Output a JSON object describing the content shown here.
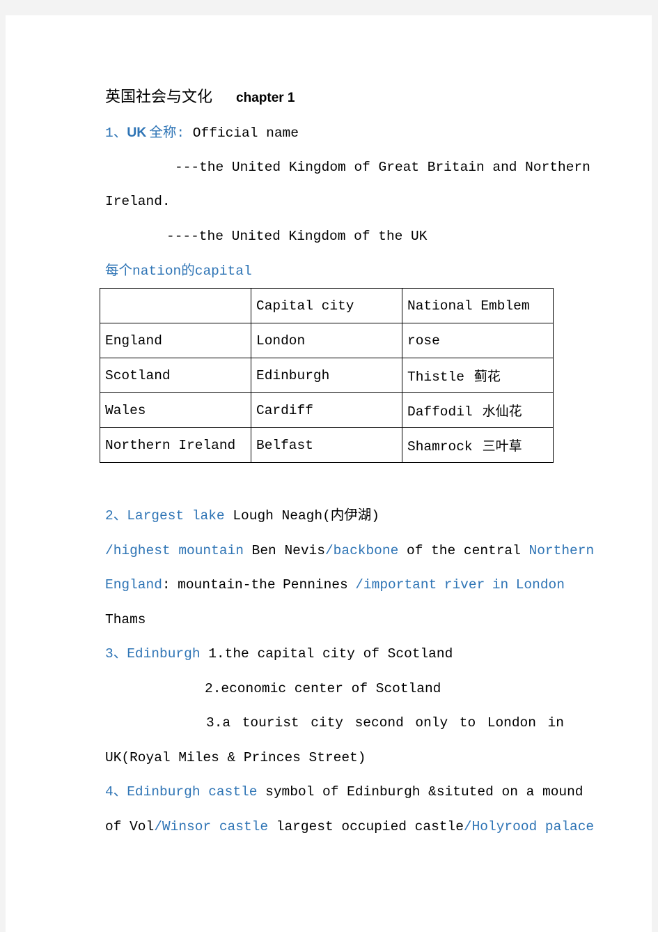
{
  "document": {
    "title_cn": "英国社会与文化",
    "title_en": "chapter 1",
    "colors": {
      "accent_blue": "#2e74b5",
      "text": "#000000",
      "background": "#f3f3f3",
      "page": "#ffffff"
    },
    "section1": {
      "number": "1、",
      "label_en": "UK",
      "label_cn": "全称",
      "colon": ": ",
      "rest": "Official name",
      "line2": "---the United Kingdom of Great Britain and Northern",
      "line3": "Ireland.",
      "line4": "----the United Kingdom of the UK",
      "subheading_parts": [
        "每个",
        "nation",
        "的",
        "capital"
      ]
    },
    "table": {
      "headers": [
        "",
        "Capital city",
        "National Emblem"
      ],
      "rows": [
        {
          "nation": "England",
          "capital": "London",
          "emblem": "rose",
          "emblem_cn": ""
        },
        {
          "nation": "Scotland",
          "capital": "Edinburgh",
          "emblem": "Thistle",
          "emblem_cn": "蓟花"
        },
        {
          "nation": "Wales",
          "capital": "Cardiff",
          "emblem": "Daffodil",
          "emblem_cn": "水仙花"
        },
        {
          "nation": "Northern Ireland",
          "capital": "Belfast",
          "emblem": "Shamrock",
          "emblem_cn": "三叶草"
        }
      ]
    },
    "section2": {
      "number": "2、",
      "l1_blue": "Largest lake",
      "l1_black": "Lough Neagh(内伊湖)",
      "l2": [
        {
          "text": "/highest mountain",
          "blue": true
        },
        {
          "text": " Ben Nevis",
          "blue": false
        },
        {
          "text": "/backbone",
          "blue": true
        },
        {
          "text": " of the central ",
          "blue": false
        },
        {
          "text": "Northern",
          "blue": true
        }
      ],
      "l3": [
        {
          "text": "England",
          "blue": true
        },
        {
          "text": ":",
          "blue": false
        },
        {
          "text": "mountain-the",
          "blue": false
        },
        {
          "text": "Pennines",
          "blue": false
        },
        {
          "text": "/important",
          "blue": true
        },
        {
          "text": "river",
          "blue": true
        },
        {
          "text": "in",
          "blue": true
        },
        {
          "text": "London",
          "blue": true
        }
      ],
      "l4": "Thams"
    },
    "section3": {
      "number": "3、",
      "label": "Edinburgh",
      "item1": "1.the capital city of Scotland",
      "item2": "2.economic center of Scotland",
      "item3_words": [
        "3.a",
        "tourist",
        "city",
        "second",
        "only",
        "to",
        "London",
        "in"
      ],
      "item3_cont": "UK(Royal Miles & Princes Street)"
    },
    "section4": {
      "number": "4、",
      "label": "Edinburgh castle",
      "l1_rest": " symbol of Edinburgh &situted on a mound",
      "l2": [
        {
          "text": "of Vol",
          "blue": false
        },
        {
          "text": "/Winsor castle",
          "blue": true
        },
        {
          "text": " largest occupied castle",
          "blue": false
        },
        {
          "text": "/Holyrood palace",
          "blue": true
        }
      ]
    }
  }
}
